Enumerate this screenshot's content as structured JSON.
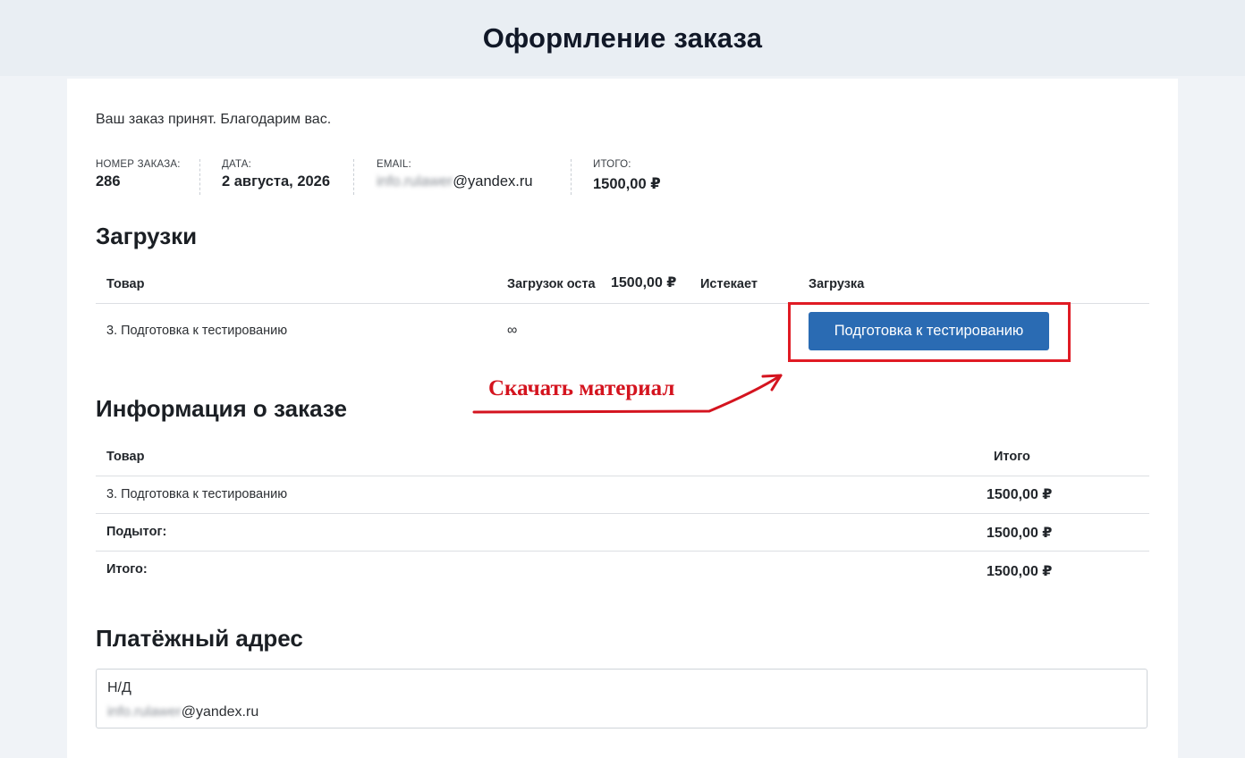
{
  "page": {
    "title": "Оформление заказа"
  },
  "thanks_message": "Ваш заказ принят. Благодарим вас.",
  "overview": {
    "order_number": {
      "label": "НОМЕР ЗАКАЗА:",
      "value": "286"
    },
    "date": {
      "label": "ДАТА:",
      "value": "2 августа, 2026"
    },
    "email": {
      "label": "EMAIL:",
      "value_blurred": "info.rulawer",
      "value_domain": "@yandex.ru"
    },
    "total": {
      "label": "ИТОГО:",
      "value": "1500,00 ₽"
    }
  },
  "downloads": {
    "heading": "Загрузки",
    "columns": {
      "product": "Товар",
      "remaining": "Загрузок оста",
      "price_overlay": "1500,00 ₽",
      "expires": "Истекает",
      "download": "Загрузка"
    },
    "row": {
      "product": "3. Подготовка к тестированию",
      "remaining": "∞",
      "button_label": "Подготовка к тестированию"
    }
  },
  "annotation": {
    "text": "Скачать материал",
    "color": "#d4141f"
  },
  "order_info": {
    "heading": "Информация о заказе",
    "columns": {
      "product": "Товар",
      "total": "Итого"
    },
    "rows": [
      {
        "label": "3. Подготовка к тестированию",
        "value": "1500,00 ₽",
        "bold_label": false
      },
      {
        "label": "Подытог:",
        "value": "1500,00 ₽",
        "bold_label": true
      },
      {
        "label": "Итого:",
        "value": "1500,00 ₽",
        "bold_label": true
      }
    ]
  },
  "billing": {
    "heading": "Платёжный адрес",
    "name": "Н/Д",
    "email_blurred": "info.rulawer",
    "email_domain": "@yandex.ru"
  },
  "colors": {
    "accent_button": "#2a6bb3",
    "highlight": "#e01b24",
    "header_bg": "#e9eef3"
  }
}
